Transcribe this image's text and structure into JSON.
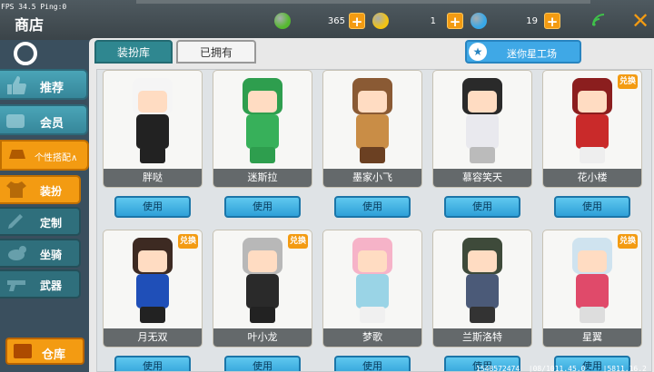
{
  "status": {
    "fps": "FPS 34.5  Ping:0"
  },
  "header": {
    "title": "商店",
    "currencies": [
      {
        "icon": "green-gem-icon",
        "color": "#56b930",
        "value": "365"
      },
      {
        "icon": "gold-coin-icon",
        "color": "#f2c313",
        "value": "1"
      },
      {
        "icon": "mini-bean-icon",
        "color": "#38a8e8",
        "value": "19"
      }
    ],
    "plus_label": "+",
    "close_label": "✕"
  },
  "sidebar": {
    "items": [
      {
        "label": "推荐",
        "icon": "thumbs-up-icon"
      },
      {
        "label": "会员",
        "icon": "vip-icon"
      }
    ],
    "custom": {
      "label": "个性搭配∧",
      "icon": "hat-icon"
    },
    "sub_items": [
      {
        "label": "装扮",
        "icon": "outfit-icon",
        "active": true
      },
      {
        "label": "定制",
        "icon": "brush-icon",
        "active": false
      },
      {
        "label": "坐骑",
        "icon": "mount-icon",
        "active": false
      },
      {
        "label": "武器",
        "icon": "gun-icon",
        "active": false
      }
    ],
    "warehouse": {
      "label": "仓库",
      "icon": "chest-icon"
    }
  },
  "tabs": [
    {
      "label": "装扮库"
    },
    {
      "label": "已拥有"
    }
  ],
  "gallery_button": {
    "label": "迷你星工场",
    "icon_glyph": "★"
  },
  "accent_colors": {
    "orange": "#f39b12",
    "blue": "#3fa8e6",
    "teal": "#2f8790"
  },
  "skins": [
    {
      "name": "胖哒",
      "badge": "",
      "head": "#f5f5f5",
      "body": "#222",
      "legs": "#222"
    },
    {
      "name": "迷斯拉",
      "badge": "",
      "head": "#2e9e4e",
      "body": "#37b05a",
      "legs": "#2e9e4e"
    },
    {
      "name": "墨家小飞",
      "badge": "",
      "head": "#8a5a34",
      "body": "#c98d46",
      "legs": "#6b4022"
    },
    {
      "name": "慕容笑天",
      "badge": "",
      "head": "#2a2a2a",
      "body": "#e9e9ee",
      "legs": "#bbb"
    },
    {
      "name": "花小楼",
      "badge": "兑换",
      "head": "#8b1e1e",
      "body": "#c92a2a",
      "legs": "#eee"
    },
    {
      "name": "月无双",
      "badge": "兑换",
      "head": "#3d2a22",
      "body": "#1f4fb8",
      "legs": "#222"
    },
    {
      "name": "叶小龙",
      "badge": "兑换",
      "head": "#b8b8b8",
      "body": "#2a2a2a",
      "legs": "#222"
    },
    {
      "name": "梦歌",
      "badge": "",
      "head": "#f6b3c8",
      "body": "#9ad4e6",
      "legs": "#f0f0f0"
    },
    {
      "name": "兰斯洛特",
      "badge": "",
      "head": "#3e4a3a",
      "body": "#4b5a78",
      "legs": "#333"
    },
    {
      "name": "星翼",
      "badge": "兑换",
      "head": "#cfe3ef",
      "body": "#e04a6a",
      "legs": "#ddd"
    }
  ],
  "use_label": "使用",
  "footer": {
    "coords": "1548572474  |08/1011.45.0    |5811.16.2"
  }
}
